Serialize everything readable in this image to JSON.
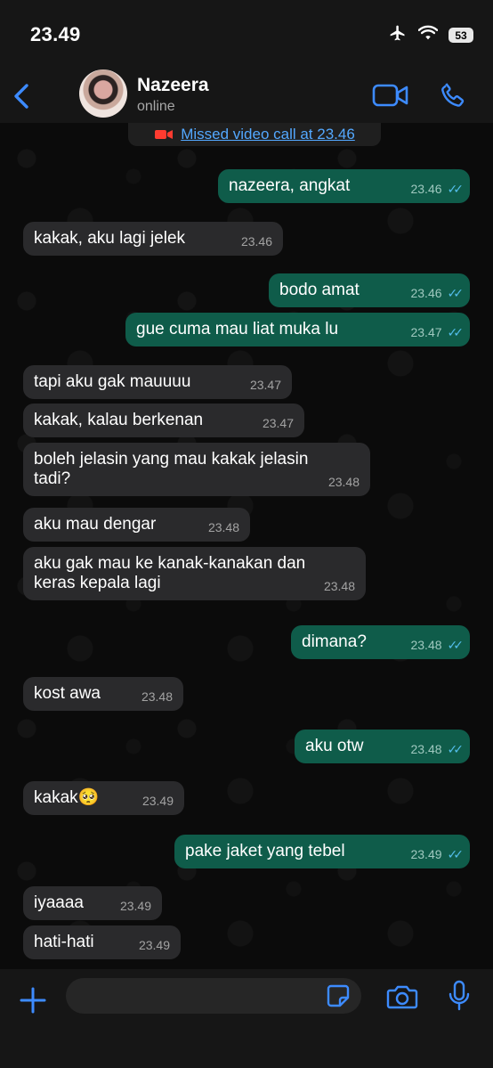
{
  "status_bar": {
    "time": "23.49",
    "battery": "53"
  },
  "header": {
    "contact_name": "Nazeera",
    "contact_status": "online"
  },
  "missed_call": {
    "text": "Missed video call at 23.46"
  },
  "messages": [
    {
      "dir": "out",
      "text": "nazeera, angkat",
      "time": "23.46",
      "read": true
    },
    {
      "dir": "in",
      "text": "kakak, aku lagi jelek",
      "time": "23.46"
    },
    {
      "dir": "out",
      "text": "bodo amat",
      "time": "23.46",
      "read": true
    },
    {
      "dir": "out",
      "text": "gue cuma mau liat muka lu",
      "time": "23.47",
      "read": true
    },
    {
      "dir": "in",
      "text": "tapi aku gak mauuuu",
      "time": "23.47"
    },
    {
      "dir": "in",
      "text": "kakak, kalau berkenan",
      "time": "23.47"
    },
    {
      "dir": "in",
      "text": "boleh jelasin yang mau kakak jelasin\ntadi?",
      "time": "23.48"
    },
    {
      "dir": "in",
      "text": "aku mau dengar",
      "time": "23.48"
    },
    {
      "dir": "in",
      "text": "aku gak mau ke kanak-kanakan dan\nkeras kepala lagi",
      "time": "23.48"
    },
    {
      "dir": "out",
      "text": "dimana?",
      "time": "23.48",
      "read": true
    },
    {
      "dir": "in",
      "text": "kost awa",
      "time": "23.48"
    },
    {
      "dir": "out",
      "text": "aku otw",
      "time": "23.48",
      "read": true
    },
    {
      "dir": "in",
      "text": "kakak🥺",
      "time": "23.49"
    },
    {
      "dir": "out",
      "text": "pake jaket yang tebel",
      "time": "23.49",
      "read": true
    },
    {
      "dir": "in",
      "text": "iyaaaa",
      "time": "23.49"
    },
    {
      "dir": "in",
      "text": "hati-hati",
      "time": "23.49"
    }
  ],
  "composer": {
    "input_value": ""
  },
  "colors": {
    "incoming_bubble": "#2a2a2c",
    "outgoing_bubble": "#0f5c4a",
    "accent_blue": "#3d8bff",
    "read_tick": "#53bdeb",
    "missed_call_icon": "#ff3b30"
  },
  "icons": [
    "airplane-icon",
    "wifi-icon",
    "battery-icon",
    "back-icon",
    "video-call-icon",
    "phone-icon",
    "missed-video-icon",
    "plus-icon",
    "sticker-icon",
    "camera-icon",
    "mic-icon",
    "read-tick-icon"
  ]
}
